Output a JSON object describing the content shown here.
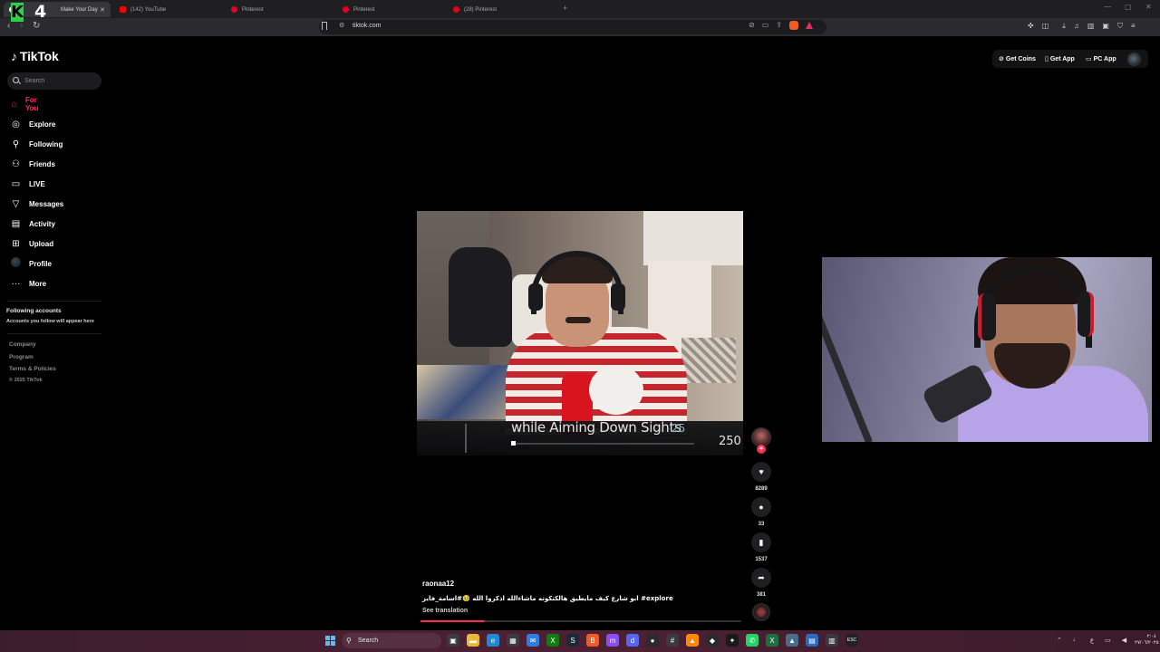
{
  "browser": {
    "tabs": [
      {
        "label": "Make Your Day",
        "favicon_color": "#ffffff",
        "active": true
      },
      {
        "label": "(142) YouTube",
        "favicon_color": "#ff0000",
        "active": false
      },
      {
        "label": "Pinterest",
        "favicon_color": "#e60023",
        "active": false
      },
      {
        "label": "Pinterest",
        "favicon_color": "#e60023",
        "active": false
      },
      {
        "label": "(28) Pinterest",
        "favicon_color": "#e60023",
        "active": false
      }
    ],
    "new_tab_icon": "plus-icon",
    "url": "tiktok.com",
    "overlay_logo": {
      "letter": "K",
      "number": "4"
    }
  },
  "tiktok": {
    "brand": "TikTok",
    "search_placeholder": "Search",
    "nav": [
      {
        "label": "For You",
        "icon": "home-icon",
        "glyph": "⌂",
        "active": true
      },
      {
        "label": "Explore",
        "icon": "compass-icon",
        "glyph": "◎",
        "active": false
      },
      {
        "label": "Following",
        "icon": "person-follow-icon",
        "glyph": "⚲",
        "active": false
      },
      {
        "label": "Friends",
        "icon": "friends-icon",
        "glyph": "⚇",
        "active": false
      },
      {
        "label": "LIVE",
        "icon": "live-icon",
        "glyph": "▭",
        "active": false
      },
      {
        "label": "Messages",
        "icon": "messages-icon",
        "glyph": "▽",
        "active": false
      },
      {
        "label": "Activity",
        "icon": "activity-icon",
        "glyph": "▤",
        "active": false
      },
      {
        "label": "Upload",
        "icon": "upload-icon",
        "glyph": "⊞",
        "active": false
      },
      {
        "label": "Profile",
        "icon": "profile-avatar-icon",
        "glyph": "",
        "active": false
      },
      {
        "label": "More",
        "icon": "more-dots-icon",
        "glyph": "···",
        "active": false
      }
    ],
    "following_accounts": {
      "title": "Following accounts",
      "subtitle": "Accounts you follow will appear here"
    },
    "footer": {
      "links": [
        "Company",
        "Program",
        "Terms & Policies"
      ],
      "copyright": "© 2025 TikTok"
    },
    "header": {
      "get_coins": "Get Coins",
      "get_app": "Get App",
      "pc_app": "PC App"
    },
    "video": {
      "overlay_text": "while Aiming Down Sights",
      "overlay_num_1": "25",
      "overlay_num_2": "250"
    },
    "actions": {
      "likes": "8289",
      "comments": "33",
      "saves": "1537",
      "shares": "381"
    },
    "caption": {
      "username": "raonaa12",
      "text": "ابو شارع كيف مايطيق هالكتكوته ماشاءالله اذكروا الله 🥹#اسامة_فايز #explore",
      "see_translation": "See translation",
      "progress": 0.2
    }
  },
  "taskbar": {
    "search_label": "Search",
    "apps": [
      {
        "name": "task-view-icon",
        "color": "#3a3a3e",
        "glyph": "▣"
      },
      {
        "name": "file-explorer-icon",
        "color": "#e8b93a",
        "glyph": "▬"
      },
      {
        "name": "edge-icon",
        "color": "#1f8ad2",
        "glyph": "e"
      },
      {
        "name": "store-icon",
        "color": "#3b3b40",
        "glyph": "▦"
      },
      {
        "name": "mail-icon",
        "color": "#2e7de0",
        "glyph": "✉"
      },
      {
        "name": "xbox-icon",
        "color": "#107c10",
        "glyph": "X"
      },
      {
        "name": "steam-icon",
        "color": "#1b2838",
        "glyph": "S"
      },
      {
        "name": "brave-icon",
        "color": "#f05a24",
        "glyph": "B"
      },
      {
        "name": "messenger-icon",
        "color": "#8a4df0",
        "glyph": "m"
      },
      {
        "name": "discord-icon",
        "color": "#5865f2",
        "glyph": "d"
      },
      {
        "name": "obs-icon",
        "color": "#2b2b2f",
        "glyph": "●"
      },
      {
        "name": "calculator-icon",
        "color": "#3a3a3e",
        "glyph": "#"
      },
      {
        "name": "vlc-icon",
        "color": "#ff8800",
        "glyph": "▲"
      },
      {
        "name": "epic-icon",
        "color": "#2a2a2a",
        "glyph": "◆"
      },
      {
        "name": "chatgpt-icon",
        "color": "#1a1a1a",
        "glyph": "✦"
      },
      {
        "name": "whatsapp-icon",
        "color": "#25d366",
        "glyph": "✆"
      },
      {
        "name": "excel-icon",
        "color": "#1d6f42",
        "glyph": "X"
      },
      {
        "name": "photos-icon",
        "color": "#4a6d8c",
        "glyph": "▲"
      },
      {
        "name": "notes-icon",
        "color": "#2a6ac2",
        "glyph": "▤"
      },
      {
        "name": "display-icon",
        "color": "#3a3a3e",
        "glyph": "▥"
      },
      {
        "name": "esc-icon",
        "color": "#222",
        "glyph": "ESC"
      }
    ],
    "tray_lang": "ع",
    "clock_time": "٢:٠٤",
    "clock_date": "٢٧/٠٦/٢٠٢٥"
  },
  "colors": {
    "accent": "#fe2c55",
    "background": "#000000"
  }
}
